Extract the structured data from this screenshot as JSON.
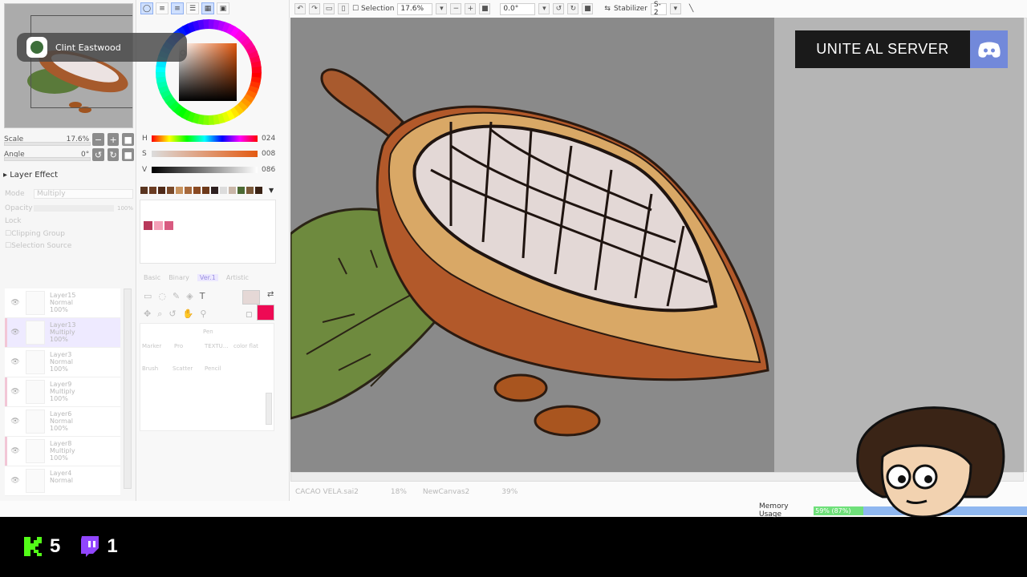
{
  "navigator": {
    "scale_label": "Scale",
    "scale_value": "17.6%",
    "angle_label": "Angle",
    "angle_value": "0°"
  },
  "toast": {
    "name": "Clint Eastwood"
  },
  "layer_effect": {
    "title": "Layer Effect",
    "mode_label": "Mode",
    "mode_value": "Multiply",
    "opacity_label": "Opacity",
    "opacity_value": "100%",
    "lock_label": "Lock",
    "clipping_label": "Clipping Group",
    "selection_label": "Selection Source"
  },
  "layers": [
    {
      "name": "Layer15",
      "mode": "Normal",
      "opacity": "100%",
      "selected": false,
      "pink": false
    },
    {
      "name": "Layer13",
      "mode": "Multiply",
      "opacity": "100%",
      "selected": true,
      "pink": true
    },
    {
      "name": "Layer3",
      "mode": "Normal",
      "opacity": "100%",
      "selected": false,
      "pink": false
    },
    {
      "name": "Layer9",
      "mode": "Multiply",
      "opacity": "100%",
      "selected": false,
      "pink": true
    },
    {
      "name": "Layer6",
      "mode": "Normal",
      "opacity": "100%",
      "selected": false,
      "pink": false
    },
    {
      "name": "Layer8",
      "mode": "Multiply",
      "opacity": "100%",
      "selected": false,
      "pink": true
    },
    {
      "name": "Layer4",
      "mode": "Normal",
      "opacity": "",
      "selected": false,
      "pink": false
    }
  ],
  "color": {
    "h_label": "H",
    "h_value": "024",
    "s_label": "S",
    "s_value": "008",
    "v_label": "V",
    "v_value": "086",
    "primary": "#ee0a54",
    "secondary": "#e5d8d6",
    "swatches": [
      "#5a3520",
      "#6b3c22",
      "#4f2a18",
      "#7a4a2a",
      "#c8935e",
      "#a7693c",
      "#8a4a22",
      "#6e3a1a",
      "#2e2020",
      "#dcdcdc",
      "#c9b6a8",
      "#4c6a34",
      "#7b5a3a",
      "#3a2214"
    ],
    "palette": [
      "#b8385a",
      "#f4a0b8",
      "#d85a80"
    ]
  },
  "tool_tabs": {
    "basic": "Basic",
    "binary": "Binary",
    "ver1": "Ver.1",
    "artistic": "Artistic"
  },
  "tools": {
    "pen": "Pen",
    "marker": "Marker",
    "pro": "Pro",
    "textu": "TEXTU...",
    "color_flat": "color flat",
    "brush": "Brush",
    "scatter": "Scatter",
    "pencil": "Pencil"
  },
  "toolbar": {
    "selection_label": "Selection",
    "zoom_value": "17.6%",
    "rotation_value": "0.0°",
    "stabilizer_label": "Stabilizer",
    "stabilizer_value": "S-2"
  },
  "documents": [
    {
      "name": "CACAO VELA.sai2",
      "zoom": "18%"
    },
    {
      "name": "NewCanvas2",
      "zoom": "39%"
    }
  ],
  "memory": {
    "label": "Memory Usage",
    "value": "59% (87%)"
  },
  "overlay": {
    "discord_text": "UNITE AL SERVER",
    "kick_count": "5",
    "twitch_count": "1"
  },
  "accent_colors": {
    "discord": "#7289da",
    "kick": "#53fc18",
    "twitch": "#9146ff"
  }
}
